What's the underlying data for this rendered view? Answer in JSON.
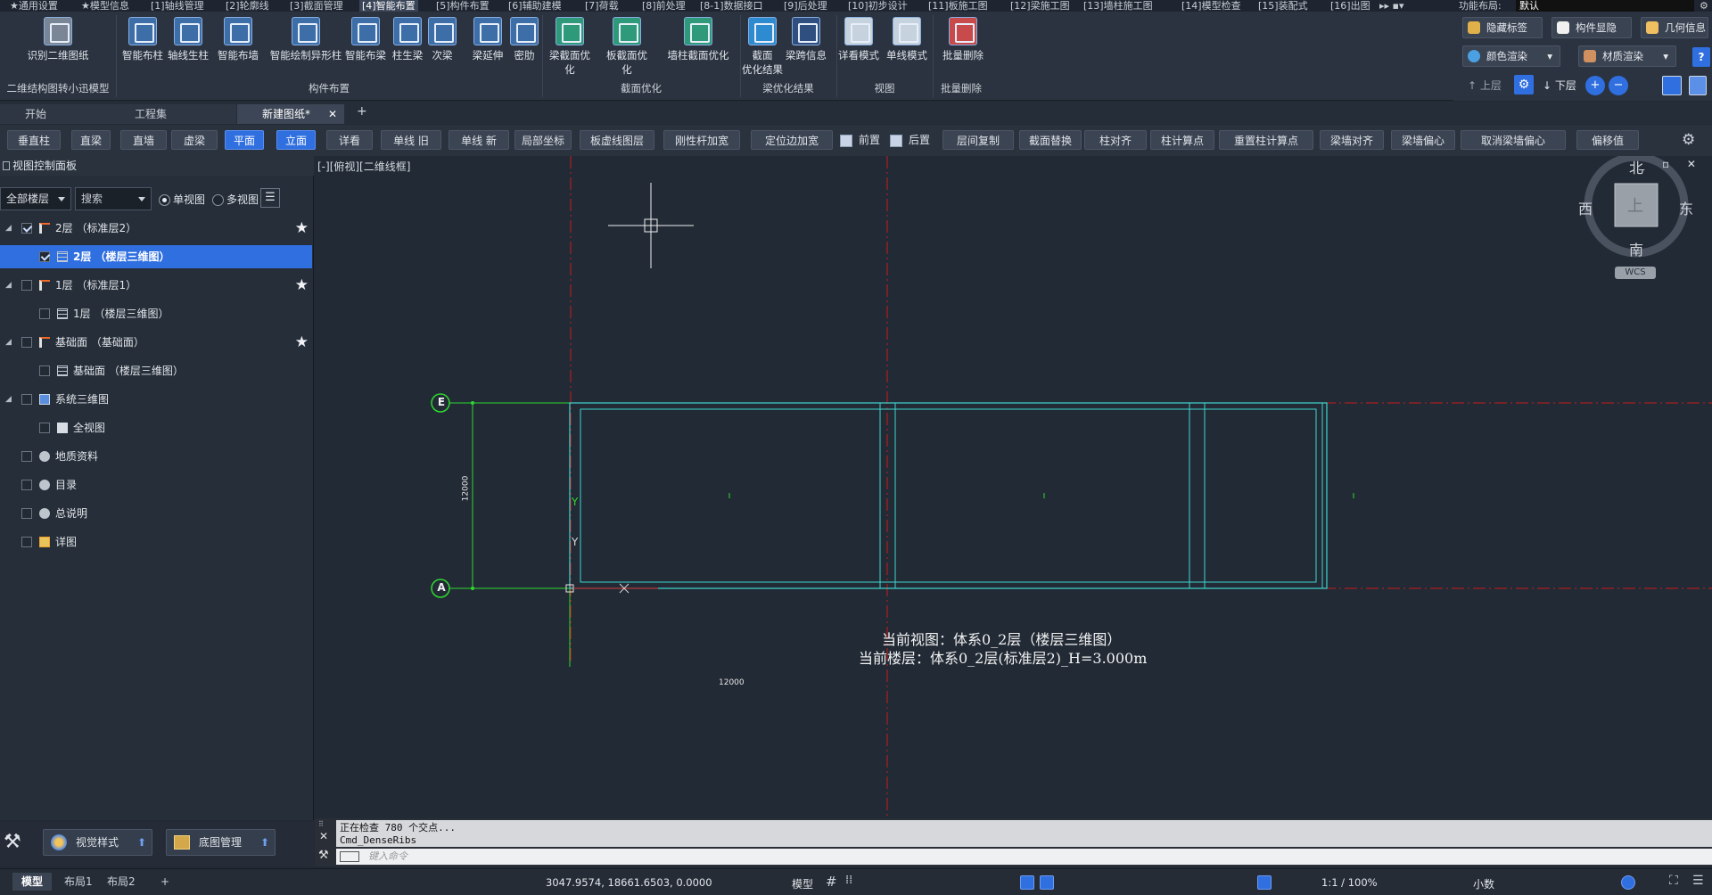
{
  "menu": [
    {
      "label": "★通用设置",
      "active": false
    },
    {
      "label": "★模型信息",
      "active": false
    },
    {
      "label": "[1]轴线管理",
      "active": false
    },
    {
      "label": "[2]轮廓线",
      "active": false
    },
    {
      "label": "[3]截面管理",
      "active": false
    },
    {
      "label": "[4]智能布置",
      "active": true
    },
    {
      "label": "[5]构件布置",
      "active": false
    },
    {
      "label": "[6]辅助建模",
      "active": false
    },
    {
      "label": "[7]荷载",
      "active": false
    },
    {
      "label": "[8]前处理",
      "active": false
    },
    {
      "label": "[8-1]数据接口",
      "active": false
    },
    {
      "label": "[9]后处理",
      "active": false
    },
    {
      "label": "[10]初步设计",
      "active": false
    },
    {
      "label": "[11]板施工图",
      "active": false
    },
    {
      "label": "[12]梁施工图",
      "active": false
    },
    {
      "label": "[13]墙柱施工图",
      "active": false
    },
    {
      "label": "[14]模型检查",
      "active": false
    },
    {
      "label": "[15]装配式",
      "active": false
    },
    {
      "label": "[16]出图",
      "active": false
    }
  ],
  "layout_label": "功能布局:",
  "layout_value": "默认",
  "ribbon": {
    "buttons": [
      {
        "label": "识别二维图纸"
      },
      {
        "label": "智能布柱"
      },
      {
        "label": "轴线生柱"
      },
      {
        "label": "智能布墙"
      },
      {
        "label": "智能绘制异形柱"
      },
      {
        "label": "智能布梁"
      },
      {
        "label": "柱生梁"
      },
      {
        "label": "次梁"
      },
      {
        "label": "梁延伸"
      },
      {
        "label": "密肋"
      },
      {
        "label": "梁截面优化"
      },
      {
        "label": "板截面优化"
      },
      {
        "label": "墙柱截面优化"
      },
      {
        "label": "截面\n优化结果"
      },
      {
        "label": "梁跨信息"
      },
      {
        "label": "详看模式"
      },
      {
        "label": "单线模式"
      },
      {
        "label": "批量删除"
      }
    ],
    "groups": [
      {
        "label": "二维结构图转小迅模型"
      },
      {
        "label": "构件布置"
      },
      {
        "label": "截面优化"
      },
      {
        "label": "梁优化结果"
      },
      {
        "label": "视图"
      },
      {
        "label": "批量删除"
      }
    ],
    "right": {
      "hide_label": "隐藏标签",
      "component_show": "构件显隐",
      "geometry_info": "几何信息",
      "color_render": "颜色渲染",
      "material_render": "材质渲染",
      "upper_floor": "上层",
      "lower_floor": "下层"
    }
  },
  "doc_tabs": [
    {
      "label": "开始",
      "active": false
    },
    {
      "label": "工程集",
      "active": false
    },
    {
      "label": "新建图纸*",
      "active": true
    }
  ],
  "cmd_buttons": [
    {
      "label": "垂直柱",
      "selected": false,
      "checkbox": false
    },
    {
      "label": "直梁",
      "selected": false,
      "checkbox": false
    },
    {
      "label": "直墙",
      "selected": false,
      "checkbox": false
    },
    {
      "label": "虚梁",
      "selected": false,
      "checkbox": false
    },
    {
      "label": "平面",
      "selected": true,
      "checkbox": false
    },
    {
      "label": "立面",
      "selected": true,
      "checkbox": false
    },
    {
      "label": "详看",
      "selected": false,
      "checkbox": false
    },
    {
      "label": "单线 旧",
      "selected": false,
      "checkbox": false
    },
    {
      "label": "单线 新",
      "selected": false,
      "checkbox": false
    },
    {
      "label": "局部坐标",
      "selected": false,
      "checkbox": false
    },
    {
      "label": "板虚线图层",
      "selected": false,
      "checkbox": false
    },
    {
      "label": "刚性杆加宽",
      "selected": false,
      "checkbox": false
    },
    {
      "label": "定位边加宽",
      "selected": false,
      "checkbox": false
    },
    {
      "label": "前置",
      "selected": false,
      "checkbox": true
    },
    {
      "label": "后置",
      "selected": false,
      "checkbox": true
    },
    {
      "label": "层间复制",
      "selected": false,
      "checkbox": false
    },
    {
      "label": "截面替换",
      "selected": false,
      "checkbox": false
    },
    {
      "label": "柱对齐",
      "selected": false,
      "checkbox": false
    },
    {
      "label": "柱计算点",
      "selected": false,
      "checkbox": false
    },
    {
      "label": "重置柱计算点",
      "selected": false,
      "checkbox": false
    },
    {
      "label": "梁墙对齐",
      "selected": false,
      "checkbox": false
    },
    {
      "label": "梁墙偏心",
      "selected": false,
      "checkbox": false
    },
    {
      "label": "取消梁墙偏心",
      "selected": false,
      "checkbox": false
    },
    {
      "label": "偏移值",
      "selected": false,
      "checkbox": false
    }
  ],
  "left_panel": {
    "title": "视图控制面板",
    "floor_select": "全部楼层",
    "search_placeholder": "搜索",
    "single_view": "单视图",
    "multi_view": "多视图",
    "tree": [
      {
        "label": "2层  （标准层2）",
        "level": 0,
        "checked": true,
        "selected": false,
        "star": true,
        "expander": "◢",
        "icon": "floor"
      },
      {
        "label": "2层  （楼层三维图）",
        "level": 1,
        "checked": true,
        "selected": true,
        "star": false,
        "expander": "",
        "icon": "grid"
      },
      {
        "label": "1层  （标准层1）",
        "level": 0,
        "checked": false,
        "selected": false,
        "star": true,
        "expander": "◢",
        "icon": "floor"
      },
      {
        "label": "1层  （楼层三维图）",
        "level": 1,
        "checked": false,
        "selected": false,
        "star": false,
        "expander": "",
        "icon": "grid"
      },
      {
        "label": "基础面  （基础面）",
        "level": 0,
        "checked": false,
        "selected": false,
        "star": true,
        "expander": "◢",
        "icon": "floor"
      },
      {
        "label": "基础面  （楼层三维图）",
        "level": 1,
        "checked": false,
        "selected": false,
        "star": false,
        "expander": "",
        "icon": "grid"
      },
      {
        "label": "系统三维图",
        "level": 0,
        "checked": false,
        "selected": false,
        "star": false,
        "expander": "◢",
        "icon": "system"
      },
      {
        "label": "全视图",
        "level": 1,
        "checked": false,
        "selected": false,
        "star": false,
        "expander": "",
        "icon": "square"
      },
      {
        "label": "地质资料",
        "level": 0,
        "checked": false,
        "selected": false,
        "star": false,
        "expander": "",
        "icon": "dot"
      },
      {
        "label": "目录",
        "level": 0,
        "checked": false,
        "selected": false,
        "star": false,
        "expander": "",
        "icon": "dot"
      },
      {
        "label": "总说明",
        "level": 0,
        "checked": false,
        "selected": false,
        "star": false,
        "expander": "",
        "icon": "dot"
      },
      {
        "label": "详图",
        "level": 0,
        "checked": false,
        "selected": false,
        "star": false,
        "expander": "",
        "icon": "detail"
      }
    ],
    "bottom": {
      "visual_style": "视觉样式",
      "base_map": "底图管理"
    }
  },
  "viewport": {
    "label": "[-][俯视][二维线框]",
    "compass": {
      "north": "北",
      "south": "南",
      "east": "东",
      "west": "西",
      "top": "上",
      "wcs": "WCS"
    },
    "axis_e": "E",
    "axis_a": "A",
    "dim_vertical": "12000",
    "dim_horizontal": "12000",
    "y_label": "Y",
    "info_line1": "当前视图：体系0_2层（楼层三维图）",
    "info_line2": "当前楼层：体系0_2层(标准层2)_H=3.000m"
  },
  "cmdline": {
    "line1": "正在检查 780 个交点...",
    "line2": "Cmd_DenseRibs",
    "placeholder": "键入命令"
  },
  "layouts": [
    {
      "label": "模型",
      "active": true
    },
    {
      "label": "布局1",
      "active": false
    },
    {
      "label": "布局2",
      "active": false
    }
  ],
  "status": {
    "coords": "3047.9574, 18661.6503, 0.0000",
    "mode": "模型",
    "scale": "1:1 / 100%",
    "decimal": "小数"
  },
  "colors": {
    "accent": "#2f6fe0",
    "beam": "#3fd8d0",
    "axis_green": "#2ed82e",
    "axis_red": "#d11b1b"
  }
}
